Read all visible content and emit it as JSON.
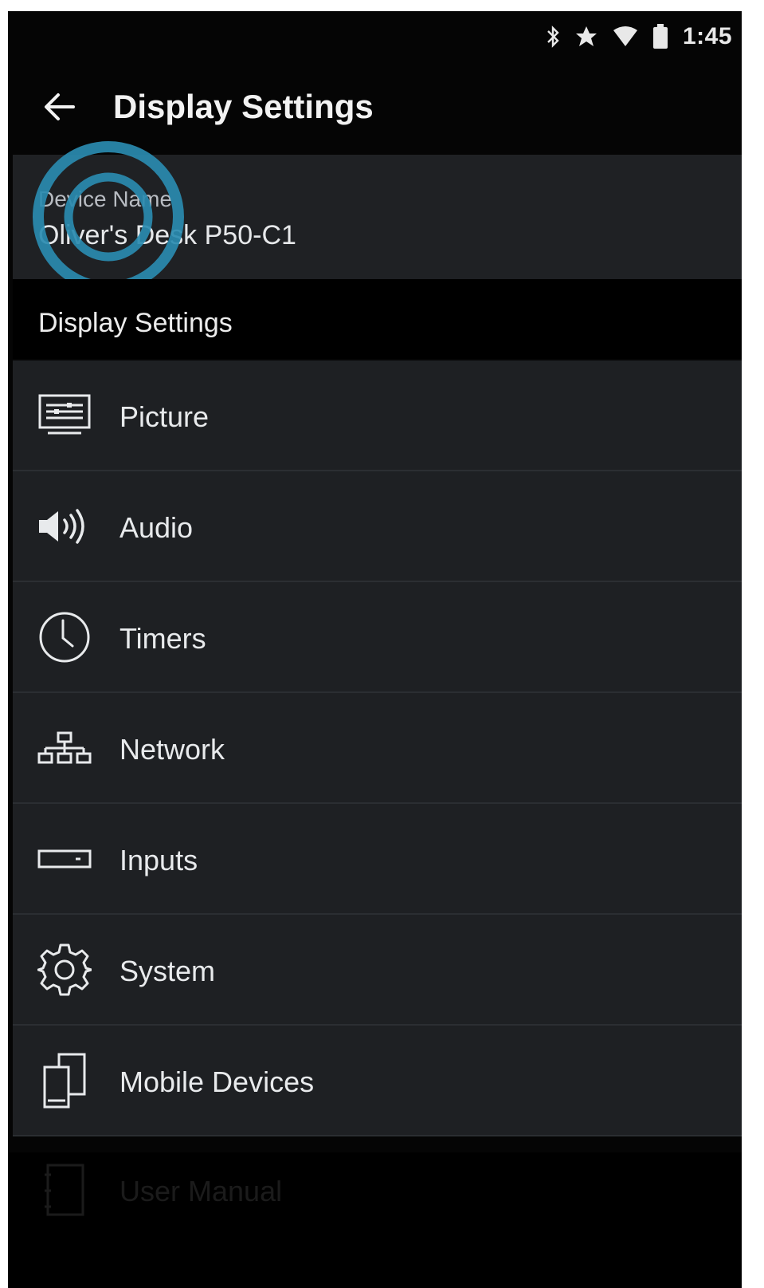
{
  "status_bar": {
    "icons": [
      "bluetooth-icon",
      "star-icon",
      "wifi-icon",
      "battery-icon"
    ],
    "time": "1:45"
  },
  "app_bar": {
    "back_icon": "arrow-left-icon",
    "title": "Display Settings"
  },
  "device": {
    "label": "Device Name",
    "value": "Oliver's Desk P50-C1"
  },
  "section": {
    "title": "Display Settings"
  },
  "menu": {
    "items": [
      {
        "label": "Picture",
        "icon": "picture-icon"
      },
      {
        "label": "Audio",
        "icon": "speaker-icon"
      },
      {
        "label": "Timers",
        "icon": "clock-icon"
      },
      {
        "label": "Network",
        "icon": "network-icon"
      },
      {
        "label": "Inputs",
        "icon": "input-icon"
      },
      {
        "label": "System",
        "icon": "gear-icon"
      },
      {
        "label": "Mobile Devices",
        "icon": "mobile-devices-icon"
      }
    ]
  },
  "partial_item": {
    "label": "User Manual",
    "icon": "manual-icon"
  },
  "colors": {
    "background": "#050505",
    "card": "#1e2023",
    "accent_tap": "#2a8bb0",
    "text": "#e8eaec"
  }
}
